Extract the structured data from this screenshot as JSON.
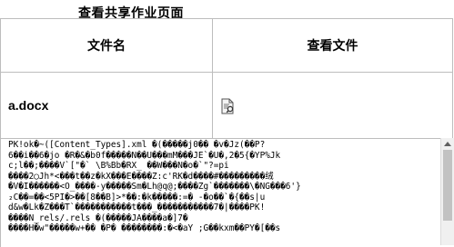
{
  "page": {
    "title": "查看共享作业页面"
  },
  "table": {
    "headers": [
      "文件名",
      "查看文件"
    ],
    "rows": [
      {
        "filename": "a.docx",
        "view_icon": "document-view-icon"
      }
    ]
  },
  "raw_content": {
    "lines": [
      "PK!ok�~([Content_Types].xml �(�����j0�� �v�Jz(��P?",
      "6��i��6�jo �R�&�b0f�����N��U���mM���JE`�U�,2�5{�YP%Jk",
      "c;l��;����V`[\"�` \\B%Bb�RX_ ��W���N�o�`\"?=pi",
      "����2◯Jh*<���t��z�kX���E����Z:c'RK�d����#���������绒",
      "�V�I������<O_����-y�����Sm�Lh@q@;����Zg`�������\\�NG���6'}",
      "₂C��=��<5PI�>��[8��B]>*��:�k�����:=� -�o��`�{��s|u",
      "d&w�Lk�Z���T`�����������t���_�����������7�|����PK!",
      "����N_rels/.rels �(�����JA����a�]7�",
      "����H�w\"�����w+�� �P� ��������:�<�aY ;G��kxm��PY�[��s"
    ]
  },
  "colors": {
    "border": "#bdbdbd",
    "scroll_thumb": "#c2c2c2"
  }
}
